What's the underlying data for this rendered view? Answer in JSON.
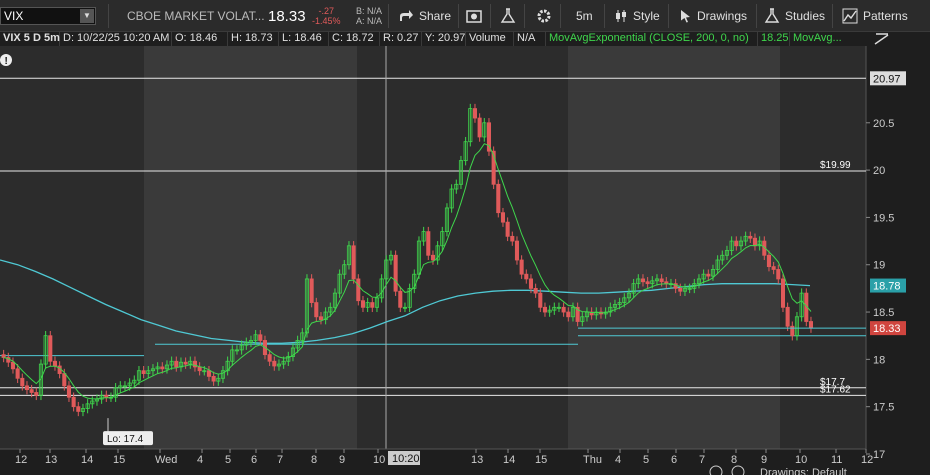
{
  "toolbar": {
    "symbol": "VIX",
    "description": "CBOE MARKET VOLAT...",
    "last": "18.33",
    "change": "-.27",
    "change_pct": "-1.45%",
    "bid": "B: N/A",
    "ask": "A: N/A",
    "share_label": "Share",
    "timeframe_label": "5m",
    "style_label": "Style",
    "drawings_label": "Drawings",
    "studies_label": "Studies",
    "patterns_label": "Patterns"
  },
  "info_bar": {
    "symbol_period": "VIX 5 D 5m",
    "date": "D: 10/22/25 10:20 AM",
    "open": "O: 18.46",
    "high": "H: 18.73",
    "low": "L: 18.46",
    "close": "C: 18.72",
    "range": "R: 0.27",
    "y": "Y: 20.97",
    "volume_label": "Volume",
    "volume_value": "N/A",
    "study": "MovAvgExponential (CLOSE, 200, 0, no)",
    "study_value": "18.25",
    "study_short": "MovAvg..."
  },
  "colors": {
    "up": "#3fd64c",
    "down": "#e05a5a",
    "ema": "#4fc9d4",
    "ema_short": "#3fd64c",
    "background": "#1e1e1e",
    "extended_session": "#2c2c2c",
    "regular_session": "#3a3a3a"
  },
  "chart_data": {
    "type": "candlestick",
    "ylim": [
      17,
      21.1
    ],
    "y_ticks": [
      17,
      17.5,
      18,
      18.5,
      19,
      19.5,
      20,
      20.5
    ],
    "x_ticks": [
      "12",
      "13",
      "14",
      "15",
      "Wed",
      "4",
      "5",
      "6",
      "7",
      "8",
      "9",
      "10",
      "10:20",
      "13",
      "14",
      "15",
      "Thu",
      "4",
      "5",
      "6",
      "7",
      "8",
      "9",
      "10",
      "11",
      "12"
    ],
    "session_bands": [
      "extended",
      "regular",
      "extended",
      "regular",
      "extended"
    ],
    "series": [
      {
        "name": "VIX 5m close",
        "values": [
          18.02,
          17.97,
          17.9,
          17.8,
          17.72,
          17.68,
          17.65,
          17.62,
          17.95,
          18.25,
          17.98,
          17.93,
          17.85,
          17.72,
          17.6,
          17.5,
          17.45,
          17.48,
          17.53,
          17.56,
          17.58,
          17.62,
          17.6,
          17.6,
          17.7,
          17.72,
          17.72,
          17.75,
          17.78,
          17.88,
          17.85,
          17.88,
          17.9,
          17.92,
          17.9,
          17.94,
          17.98,
          17.92,
          17.97,
          17.95,
          17.98,
          17.92,
          17.88,
          17.88,
          17.82,
          17.77,
          17.8,
          17.88,
          17.98,
          18.1,
          18.1,
          18.15,
          18.18,
          18.2,
          18.26,
          18.2,
          18.05,
          17.98,
          17.93,
          17.95,
          17.98,
          18.03,
          18.12,
          18.2,
          18.28,
          18.85,
          18.6,
          18.45,
          18.42,
          18.5,
          18.55,
          18.7,
          18.9,
          19.0,
          19.2,
          18.85,
          18.62,
          18.55,
          18.6,
          18.55,
          18.65,
          18.85,
          19.05,
          19.1,
          18.72,
          18.55,
          18.55,
          18.75,
          18.9,
          19.25,
          19.35,
          19.1,
          19.05,
          19.2,
          19.35,
          19.6,
          19.8,
          19.85,
          20.1,
          20.3,
          20.65,
          20.55,
          20.35,
          20.5,
          20.2,
          19.85,
          19.55,
          19.45,
          19.3,
          19.25,
          19.05,
          18.9,
          18.85,
          18.75,
          18.7,
          18.55,
          18.5,
          18.52,
          18.55,
          18.55,
          18.5,
          18.45,
          18.55,
          18.4,
          18.45,
          18.5,
          18.47,
          18.5,
          18.48,
          18.5,
          18.55,
          18.58,
          18.6,
          18.65,
          18.7,
          18.8,
          18.85,
          18.82,
          18.8,
          18.83,
          18.85,
          18.82,
          18.8,
          18.8,
          18.75,
          18.72,
          18.75,
          18.75,
          18.8,
          18.85,
          18.9,
          18.88,
          18.95,
          19.05,
          19.1,
          19.15,
          19.25,
          19.2,
          19.25,
          19.3,
          19.28,
          19.2,
          19.25,
          19.1,
          18.98,
          18.95,
          18.85,
          18.55,
          18.35,
          18.25,
          18.45,
          18.7,
          18.4,
          18.33
        ]
      },
      {
        "name": "MovAvgExponential (CLOSE, 200, 0, no)",
        "values": [
          19.05,
          19.0,
          18.93,
          18.85,
          18.76,
          18.67,
          18.58,
          18.5,
          18.42,
          18.36,
          18.3,
          18.26,
          18.22,
          18.2,
          18.18,
          18.17,
          18.17,
          18.18,
          18.2,
          18.23,
          18.27,
          18.33,
          18.4,
          18.46,
          18.55,
          18.62,
          18.67,
          18.7,
          18.72,
          18.73,
          18.73,
          18.72,
          18.71,
          18.7,
          18.7,
          18.71,
          18.72,
          18.73,
          18.75,
          18.77,
          18.79,
          18.8,
          18.8,
          18.8,
          18.8,
          18.79,
          18.78
        ]
      }
    ],
    "horizontal_levels": [
      {
        "value": 20.97,
        "label": "20.97"
      },
      {
        "value": 19.99,
        "label": "$19.99"
      },
      {
        "value": 17.7,
        "label": "$17.7"
      },
      {
        "value": 17.62,
        "label": "$17.62"
      }
    ],
    "price_markers": [
      {
        "value": 18.78,
        "label": "18.78"
      },
      {
        "value": 18.33,
        "label": "18.33"
      }
    ],
    "annotations": [
      {
        "value": 17.4,
        "label": "Lo: 17.4"
      }
    ],
    "crosshair_label": "10:20",
    "footer_text": "Drawings: Default"
  }
}
